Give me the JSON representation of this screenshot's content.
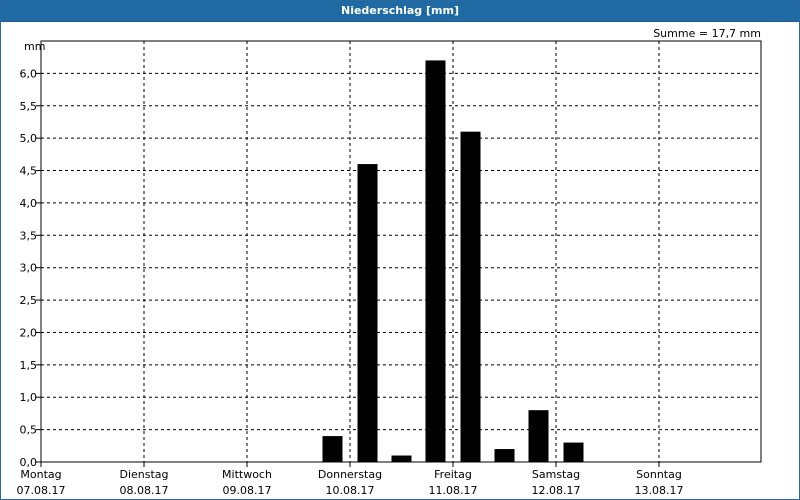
{
  "window": {
    "title": "Niederschlag [mm]"
  },
  "chart_data": {
    "type": "bar",
    "title": "Niederschlag [mm]",
    "ylabel": "mm",
    "ylim": [
      0,
      6.5
    ],
    "yticks": [
      "0,0",
      "0,5",
      "1,0",
      "1,5",
      "2,0",
      "2,5",
      "3,0",
      "3,5",
      "4,0",
      "4,5",
      "5,0",
      "5,5",
      "6,0"
    ],
    "xlim": [
      0,
      7
    ],
    "xtick_labels": [
      {
        "day": "Montag",
        "date": "07.08.17",
        "x": 0
      },
      {
        "day": "Dienstag",
        "date": "08.08.17",
        "x": 1
      },
      {
        "day": "Mittwoch",
        "date": "09.08.17",
        "x": 2
      },
      {
        "day": "Donnerstag",
        "date": "10.08.17",
        "x": 3
      },
      {
        "day": "Freitag",
        "date": "11.08.17",
        "x": 4
      },
      {
        "day": "Samstag",
        "date": "12.08.17",
        "x": 5
      },
      {
        "day": "Sonntag",
        "date": "13.08.17",
        "x": 6
      }
    ],
    "annotation": "Summe = 17,7 mm",
    "grid": true,
    "bar_color": "#000000",
    "bars": [
      {
        "x": 2.83,
        "value": 0.4
      },
      {
        "x": 3.17,
        "value": 4.6
      },
      {
        "x": 3.5,
        "value": 0.1
      },
      {
        "x": 3.83,
        "value": 6.2
      },
      {
        "x": 4.17,
        "value": 5.1
      },
      {
        "x": 4.5,
        "value": 0.2
      },
      {
        "x": 4.83,
        "value": 0.8
      },
      {
        "x": 5.17,
        "value": 0.3
      }
    ]
  }
}
